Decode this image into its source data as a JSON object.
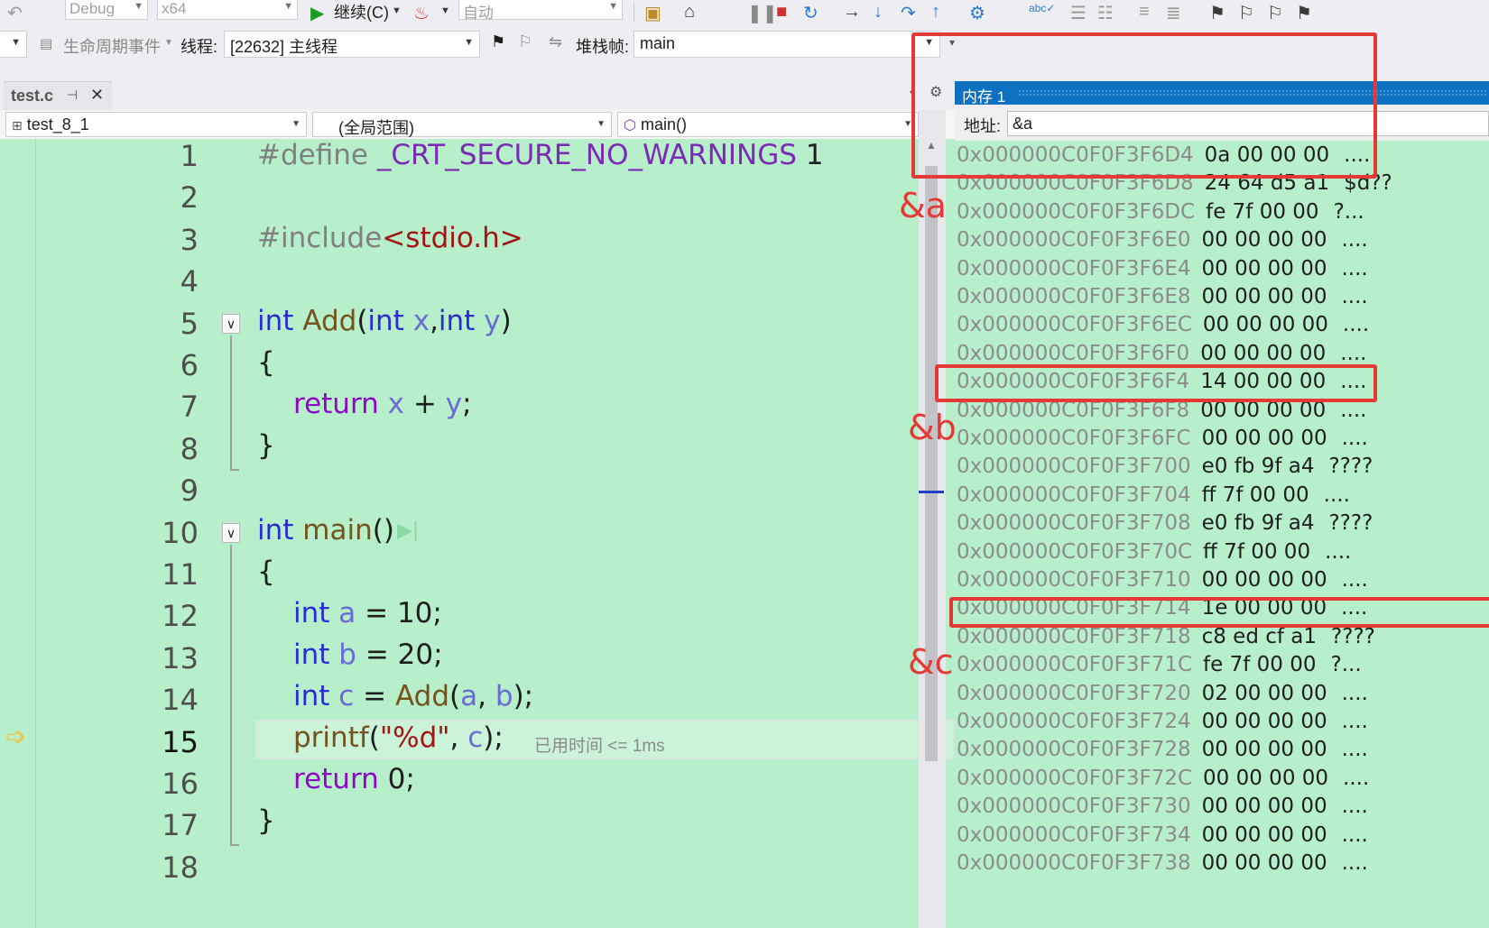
{
  "toolbar": {
    "config": "Debug",
    "platform": "x64",
    "continue": "继续(C)",
    "auto": "自动",
    "lifecycle": "生命周期事件",
    "thread_label": "线程:",
    "thread_value": "[22632] 主线程",
    "stack_label": "堆栈帧:",
    "stack_value": "main"
  },
  "tab": {
    "file": "test.c"
  },
  "navbar": {
    "project": "test_8_1",
    "scope": "(全局范围)",
    "func": "main()"
  },
  "editor": {
    "line_numbers": [
      "1",
      "2",
      "3",
      "4",
      "5",
      "6",
      "7",
      "8",
      "9",
      "10",
      "11",
      "12",
      "13",
      "14",
      "15",
      "16",
      "17",
      "18"
    ],
    "current_line": "15",
    "elapsed": "已用时间 <= 1ms"
  },
  "memory": {
    "title": "内存 1",
    "address_label": "地址:",
    "address_value": "&a",
    "rows": [
      {
        "addr": "0x000000C0F0F3F6D4",
        "bytes": "0a 00 00 00",
        "chars": "...."
      },
      {
        "addr": "0x000000C0F0F3F6D8",
        "bytes": "24 64 d5 a1",
        "chars": "$d??"
      },
      {
        "addr": "0x000000C0F0F3F6DC",
        "bytes": "fe 7f 00 00",
        "chars": "?..."
      },
      {
        "addr": "0x000000C0F0F3F6E0",
        "bytes": "00 00 00 00",
        "chars": "...."
      },
      {
        "addr": "0x000000C0F0F3F6E4",
        "bytes": "00 00 00 00",
        "chars": "...."
      },
      {
        "addr": "0x000000C0F0F3F6E8",
        "bytes": "00 00 00 00",
        "chars": "...."
      },
      {
        "addr": "0x000000C0F0F3F6EC",
        "bytes": "00 00 00 00",
        "chars": "...."
      },
      {
        "addr": "0x000000C0F0F3F6F0",
        "bytes": "00 00 00 00",
        "chars": "...."
      },
      {
        "addr": "0x000000C0F0F3F6F4",
        "bytes": "14 00 00 00",
        "chars": "...."
      },
      {
        "addr": "0x000000C0F0F3F6F8",
        "bytes": "00 00 00 00",
        "chars": "...."
      },
      {
        "addr": "0x000000C0F0F3F6FC",
        "bytes": "00 00 00 00",
        "chars": "...."
      },
      {
        "addr": "0x000000C0F0F3F700",
        "bytes": "e0 fb 9f a4",
        "chars": "????"
      },
      {
        "addr": "0x000000C0F0F3F704",
        "bytes": "ff 7f 00 00",
        "chars": "...."
      },
      {
        "addr": "0x000000C0F0F3F708",
        "bytes": "e0 fb 9f a4",
        "chars": "????"
      },
      {
        "addr": "0x000000C0F0F3F70C",
        "bytes": "ff 7f 00 00",
        "chars": "...."
      },
      {
        "addr": "0x000000C0F0F3F710",
        "bytes": "00 00 00 00",
        "chars": "...."
      },
      {
        "addr": "0x000000C0F0F3F714",
        "bytes": "1e 00 00 00",
        "chars": "...."
      },
      {
        "addr": "0x000000C0F0F3F718",
        "bytes": "c8 ed cf a1",
        "chars": "????"
      },
      {
        "addr": "0x000000C0F0F3F71C",
        "bytes": "fe 7f 00 00",
        "chars": "?..."
      },
      {
        "addr": "0x000000C0F0F3F720",
        "bytes": "02 00 00 00",
        "chars": "...."
      },
      {
        "addr": "0x000000C0F0F3F724",
        "bytes": "00 00 00 00",
        "chars": "...."
      },
      {
        "addr": "0x000000C0F0F3F728",
        "bytes": "00 00 00 00",
        "chars": "...."
      },
      {
        "addr": "0x000000C0F0F3F72C",
        "bytes": "00 00 00 00",
        "chars": "...."
      },
      {
        "addr": "0x000000C0F0F3F730",
        "bytes": "00 00 00 00",
        "chars": "...."
      },
      {
        "addr": "0x000000C0F0F3F734",
        "bytes": "00 00 00 00",
        "chars": "...."
      },
      {
        "addr": "0x000000C0F0F3F738",
        "bytes": "00 00 00 00",
        "chars": "...."
      }
    ]
  },
  "code": {
    "l1_a": "#define ",
    "l1_b": "_CRT_SECURE_NO_WARNINGS",
    "l1_c": " 1",
    "l3_a": "#include",
    "l3_b": "<stdio.h>",
    "int": "int",
    "add": "Add",
    "main": "main",
    "return": "return",
    "printf": "printf",
    "x": "x",
    "y": "y",
    "a": "a",
    "b": "b",
    "c": "c",
    "fmt": "\"%d\"",
    "open_paren": "(",
    "close_paren": ")",
    "comma": ",",
    "comma_sp": ", ",
    "plus": " + ",
    "semi": ";",
    "eq10": " = 10;",
    "eq20": " = 20;",
    "eq": " = ",
    "zero": " 0;",
    "lbrace": "{",
    "rbrace": "}",
    "main_parens": "()"
  },
  "annotations": {
    "a": "&a",
    "b": "&b",
    "c": "&c"
  },
  "colors": {
    "editor_bg": "#b6efc9",
    "annotation": "#e53935",
    "title_blue": "#0e70c0"
  }
}
